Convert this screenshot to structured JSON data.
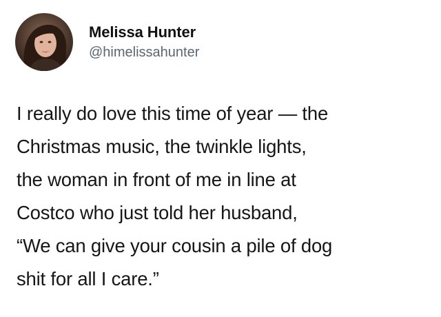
{
  "tweet": {
    "author": {
      "display_name": "Melissa Hunter",
      "handle": "@himelissahunter",
      "avatar_icon": "profile-photo"
    },
    "text_lines": [
      "I really do love this time of year — the",
      "Christmas music, the twinkle lights,",
      "the woman in front of me in line at",
      "Costco who just told her husband,",
      "“We can give your cousin a pile of dog",
      "shit for all I care.”"
    ]
  }
}
